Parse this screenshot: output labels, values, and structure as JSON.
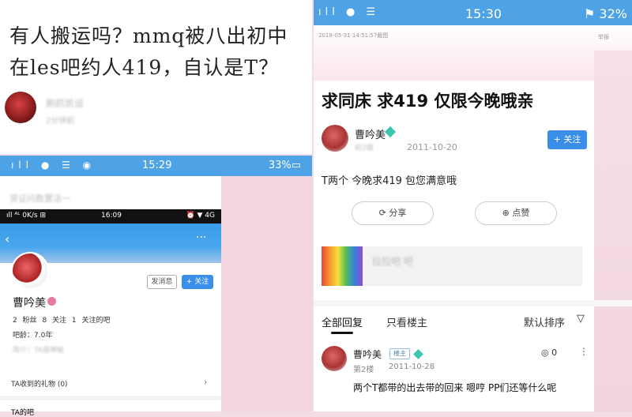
{
  "note": {
    "line1": "有人搬运吗？mmq被八出初中",
    "line2": "在les吧约人419，自认是T？",
    "user": "刷抓凯设",
    "time": "2分钟前"
  },
  "left_phone": {
    "status": {
      "time": "15:29",
      "icons": "ıll ● ☰ ◉",
      "battery": "33%▭"
    },
    "top_line": "贤证问数置活一",
    "inner_status": {
      "left": "ıll ᴬᴸ 0K/s ⊞",
      "time": "16:09",
      "right": "⏰ ▼ 4G"
    },
    "follow_label": "+ 关注",
    "message_label": "发消息",
    "name": "曹吟美",
    "stats": "2 粉丝 8 关注 1 关注的吧",
    "age": "吧龄：7.0年",
    "intro": "简介：TA很神秘",
    "gifts": "TA收到的礼物 (0)",
    "gifts_chevron": "›",
    "bottom": "TA的吧"
  },
  "right_phone": {
    "status": {
      "time": "15:30",
      "icons": "ıll ● ☰",
      "battery": "⚑ 32%"
    },
    "watermark": "2018-05-31 14:51:57截图",
    "tip": "举报",
    "title": "求同床 求419 仅限今晚哦亲",
    "post": {
      "user": "曹吟美",
      "level": "初2楼",
      "date": "2011-10-20",
      "follow_label": "+ 关注",
      "body": "T两个 今晚求419 包您满意哦"
    },
    "share_label": "⟳ 分享",
    "like_label": "⊕ 点赞",
    "forum_name": "拉拉吧 吧",
    "tabs": {
      "all": "全部回复",
      "op_only": "只看楼主",
      "sort": "默认排序",
      "sort_icon": "▽"
    },
    "reply": {
      "user": "曹吟美",
      "tag": "楼主",
      "floor": "第2楼",
      "date": "2011-10-28",
      "likes": "◎ 0",
      "more": "⋮",
      "text": "两个T都带的出去带的回来 嗯哼 PP们还等什么呢"
    }
  }
}
